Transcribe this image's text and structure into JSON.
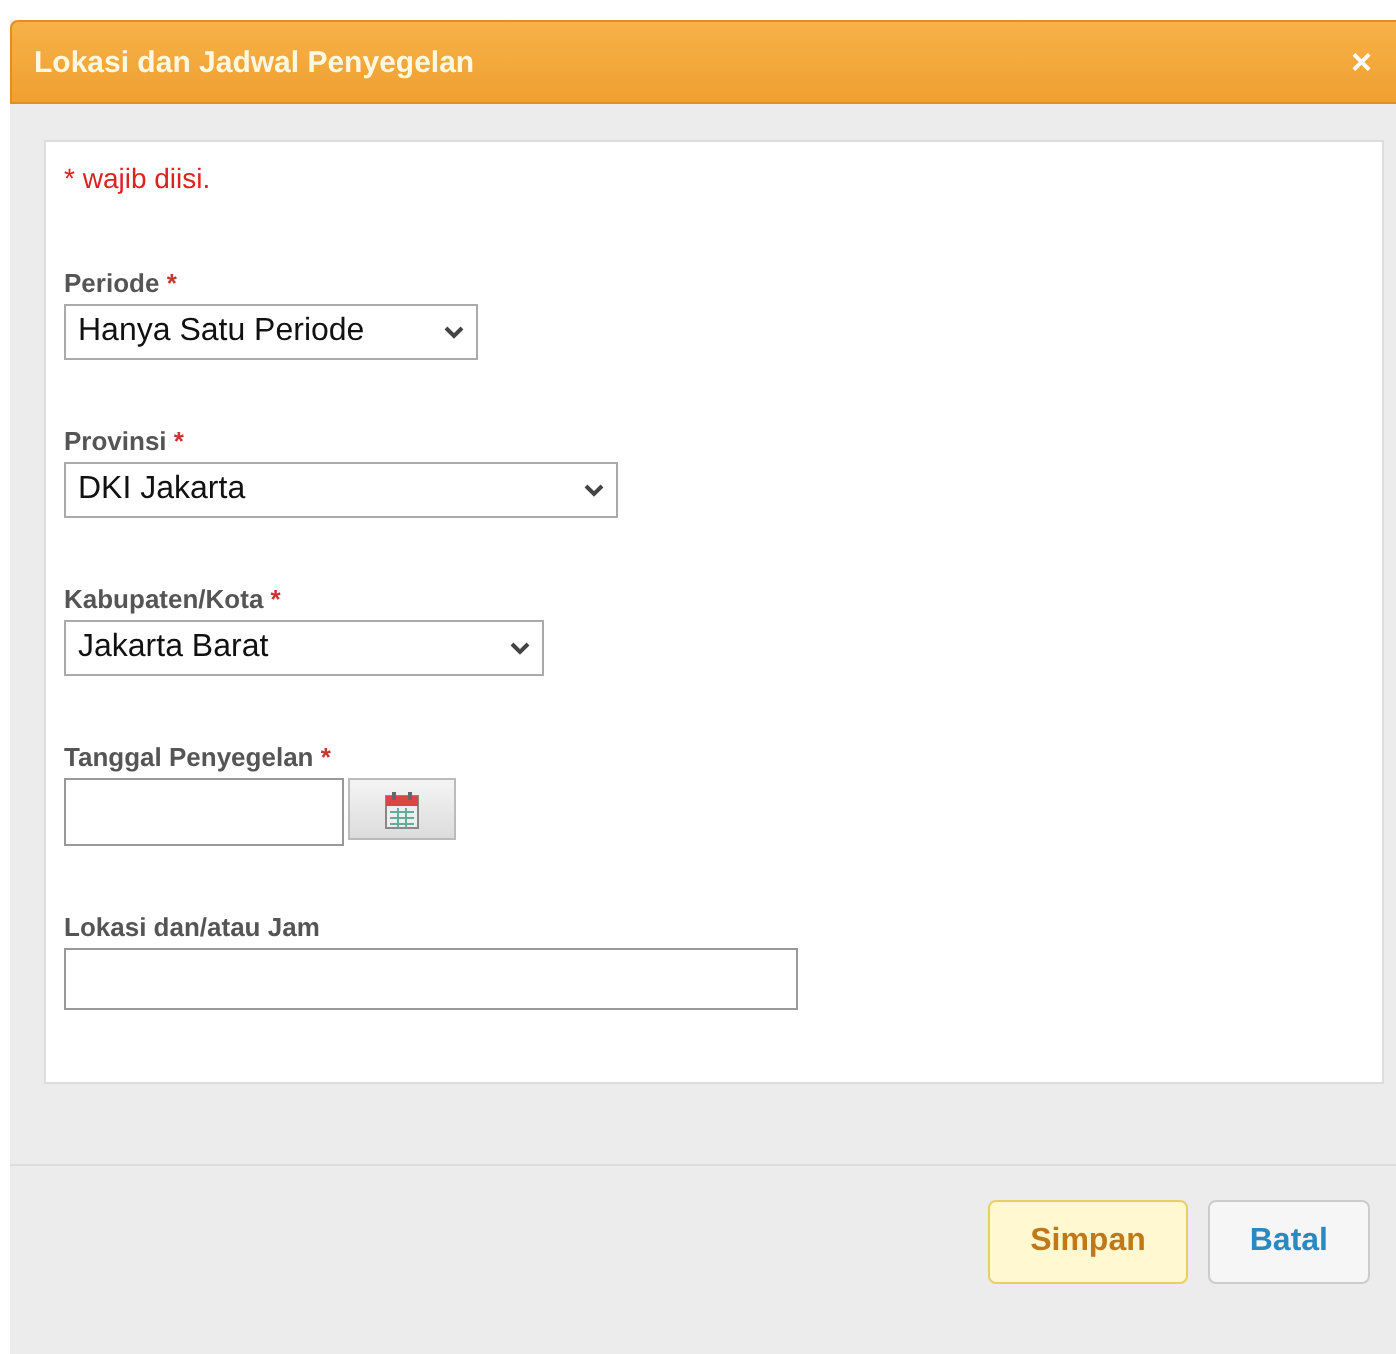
{
  "dialog": {
    "title": "Lokasi dan Jadwal Penyegelan",
    "close": "×"
  },
  "note": "* wajib diisi.",
  "fields": [
    {
      "kind": "select",
      "label": "Periode",
      "required_mark": "*",
      "value": "Hanya Satu Periode"
    },
    {
      "kind": "select",
      "label": "Provinsi",
      "required_mark": "*",
      "value": "DKI Jakarta"
    },
    {
      "kind": "select",
      "label": "Kabupaten/Kota",
      "required_mark": "*",
      "value": "Jakarta Barat"
    },
    {
      "kind": "date",
      "label": "Tanggal Penyegelan",
      "required_mark": "*"
    },
    {
      "kind": "text",
      "label": "Lokasi dan/atau Jam"
    }
  ],
  "buttons": [
    {
      "label": "Simpan",
      "kind": "primary"
    },
    {
      "label": "Batal",
      "kind": "secondary"
    }
  ]
}
